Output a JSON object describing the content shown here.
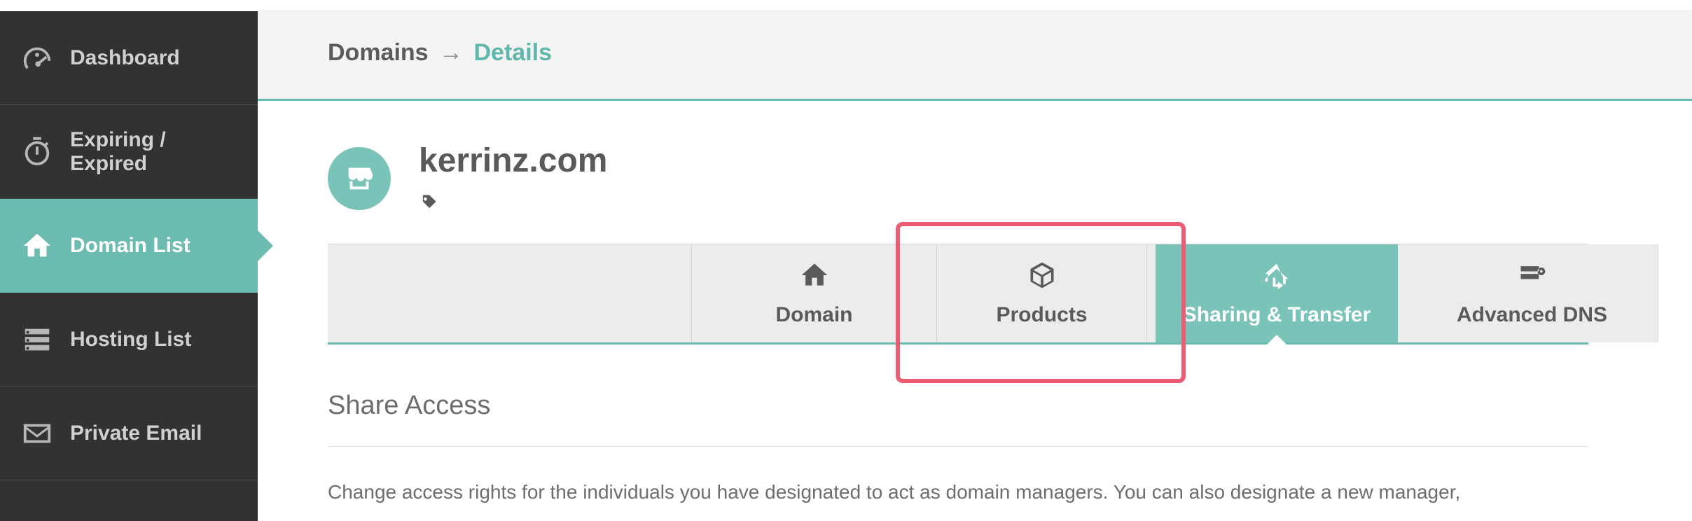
{
  "sidebar": {
    "items": [
      {
        "label": "Dashboard"
      },
      {
        "label": "Expiring / Expired"
      },
      {
        "label": "Domain List"
      },
      {
        "label": "Hosting List"
      },
      {
        "label": "Private Email"
      }
    ]
  },
  "breadcrumb": {
    "root": "Domains",
    "arrow": "→",
    "current": "Details"
  },
  "domain": {
    "name": "kerrinz.com"
  },
  "tabs": {
    "domain": "Domain",
    "products": "Products",
    "sharing": "Sharing & Transfer",
    "advanced_dns": "Advanced DNS"
  },
  "section": {
    "heading": "Share Access",
    "body": "Change access rights for the individuals you have designated to act as domain managers. You can also designate a new manager,"
  }
}
